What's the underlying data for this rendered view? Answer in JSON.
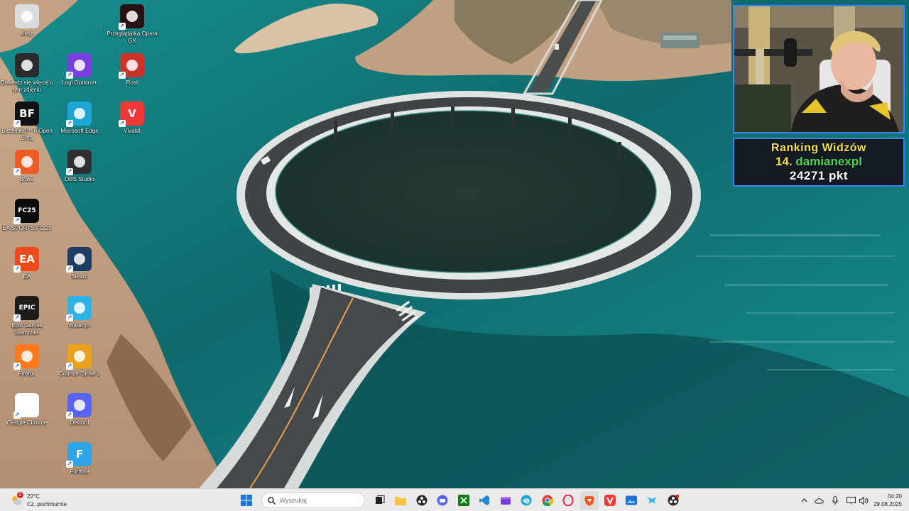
{
  "desktop": {
    "icons": [
      {
        "label": "Kosz",
        "icon": "recycle-bin-icon",
        "color": "#d9dde2"
      },
      {
        "label": "Dowiedz się więcej o tym zdjęciu",
        "icon": "camera-info-icon",
        "color": "#2b2b2b"
      },
      {
        "label": "Battlefield™ 6 Open Beta",
        "icon": "battlefield-icon",
        "color": "#111111",
        "glyph": "BF"
      },
      {
        "label": "Brave",
        "icon": "brave-lion-icon",
        "color": "#f05a24"
      },
      {
        "label": "EA SPORTS FC 25",
        "icon": "ea-fc-icon",
        "color": "#0b0b0b",
        "glyph": "FC25"
      },
      {
        "label": "EA",
        "icon": "ea-icon",
        "color": "#f04a1c",
        "glyph": "EA"
      },
      {
        "label": "Epic Games Launcher",
        "icon": "epic-games-icon",
        "color": "#1c1c1c",
        "glyph": "EPIC"
      },
      {
        "label": "Firefox",
        "icon": "firefox-icon",
        "color": "#ff7a1a"
      },
      {
        "label": "Google Chrome",
        "icon": "chrome-icon",
        "color": "#ffffff"
      },
      {
        "label": "Logi Options+",
        "icon": "logi-options-icon",
        "color": "#7b3fe0"
      },
      {
        "label": "Microsoft Edge",
        "icon": "edge-icon",
        "color": "#1fa6d8"
      },
      {
        "label": "OBS Studio",
        "icon": "obs-studio-icon",
        "color": "#2f2f2f"
      },
      {
        "label": "Steam",
        "icon": "steam-icon",
        "color": "#1b3d62"
      },
      {
        "label": "Waterfox",
        "icon": "waterfox-icon",
        "color": "#2fb3e6"
      },
      {
        "label": "Counter-Strike 2",
        "icon": "counter-strike-icon",
        "color": "#e8a21e"
      },
      {
        "label": "Discord",
        "icon": "discord-icon",
        "color": "#5865f2"
      },
      {
        "label": "Fortnite",
        "icon": "fortnite-icon",
        "color": "#2fa4e7",
        "glyph": "F"
      },
      {
        "label": "Przeglądarka Opera GX",
        "icon": "opera-gx-icon",
        "color": "#2a0f14"
      },
      {
        "label": "Rust",
        "icon": "rust-game-icon",
        "color": "#c9342a"
      },
      {
        "label": "Vivaldi",
        "icon": "vivaldi-icon",
        "color": "#ef3939",
        "glyph": "V"
      }
    ]
  },
  "overlay": {
    "ranking_title": "Ranking Widzów",
    "ranking_position": "14.",
    "ranking_name": "damianexpl",
    "ranking_points": "24271 pkt"
  },
  "taskbar": {
    "weather_temp": "22°C",
    "weather_desc": "Cz. pochmurnie",
    "weather_badge": "2",
    "search_placeholder": "Wyszukaj",
    "apps": [
      "start-icon",
      "search",
      "task-view-icon",
      "file-explorer-icon",
      "obs-studio-icon",
      "discord-icon",
      "xbox-icon",
      "vscode-icon",
      "clipchamp-icon",
      "edge-icon",
      "chrome-icon",
      "opera-gx-icon",
      "brave-icon",
      "vivaldi-icon",
      "photos-icon",
      "waterfox-icon",
      "obs-record-icon"
    ],
    "time": "04:20",
    "date": "29.08.2025"
  }
}
